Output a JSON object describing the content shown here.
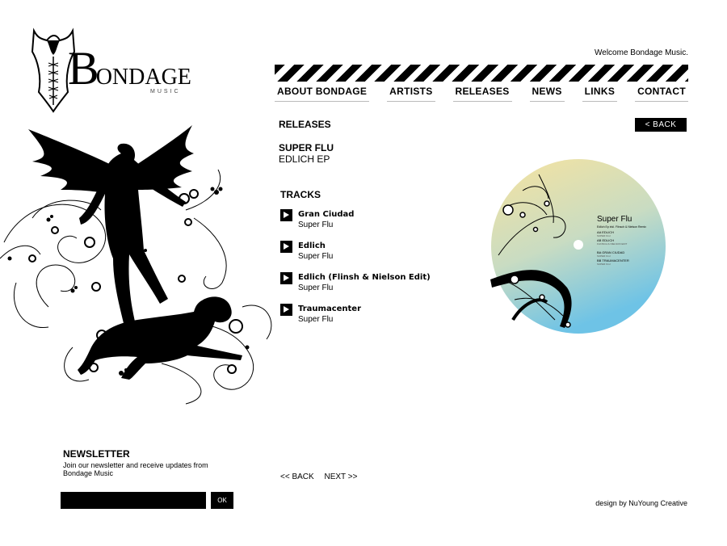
{
  "header": {
    "logo_text_big": "B",
    "logo_text_rest": "ONDAGE",
    "logo_sub": "MUSIC",
    "welcome": "Welcome Bondage Music."
  },
  "nav": [
    "ABOUT BONDAGE",
    "ARTISTS",
    "RELEASES",
    "NEWS",
    "LINKS",
    "CONTACT"
  ],
  "main": {
    "section_title": "RELEASES",
    "back_label": "<  BACK",
    "artist": "SUPER FLU",
    "release_title": "EDLICH EP",
    "tracks_title": "TRACKS",
    "tracks": [
      {
        "name": "Gran Ciudad",
        "artist": "Super Flu"
      },
      {
        "name": "Edlich",
        "artist": "Super Flu"
      },
      {
        "name": "Edlich (Flinsh & Nielson Edit)",
        "artist": "Super Flu"
      },
      {
        "name": "Traumacenter",
        "artist": "Super Flu"
      }
    ],
    "pager_back": "<<  BACK",
    "pager_next": "NEXT  >>"
  },
  "vinyl": {
    "label_title": "Super Flu",
    "label_sub": "Edlich Ep inkl. Flinsch & Nielson Remix",
    "label_tracks": [
      "AA EDLICH",
      "AB EDLICH",
      "BA GRAN CIUDAD",
      "BB TRAUMACENTER"
    ],
    "label_artists": [
      "SUPER FLU",
      "FLINSCH & NIELSON EDIT",
      "SUPER FLU",
      "SUPER FLU"
    ]
  },
  "newsletter": {
    "title": "NEWSLETTER",
    "text": "Join our newsletter and receive updates from Bondage Music",
    "input_value": "",
    "ok_label": "OK"
  },
  "footer": {
    "credit": "design by NuYoung Creative"
  },
  "colors": {
    "accent": "#000000",
    "background": "#ffffff",
    "vinyl_gradient_top": "#f4e2a3",
    "vinyl_gradient_bottom": "#7cc6e4"
  }
}
